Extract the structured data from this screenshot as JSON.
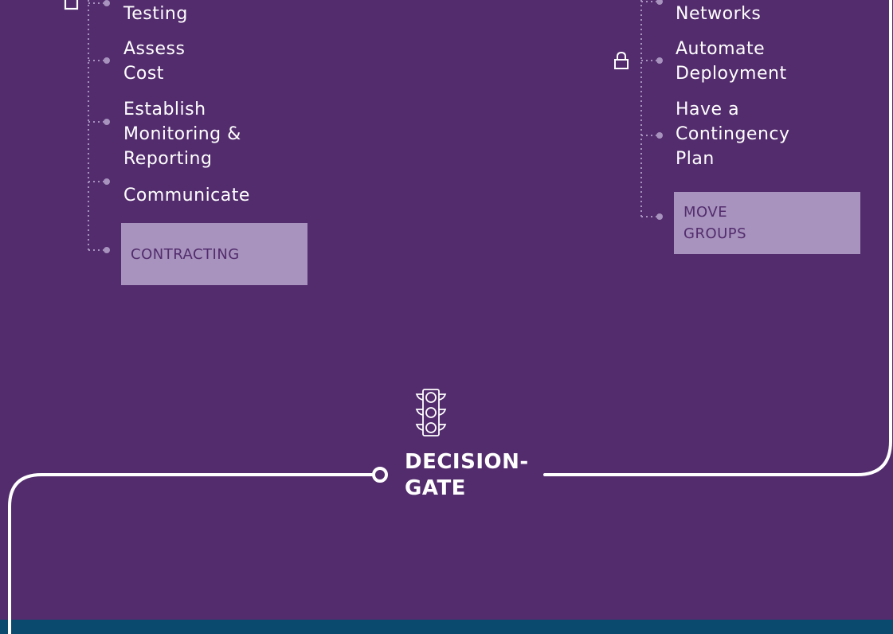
{
  "colors": {
    "background": "#532c6d",
    "box_fill": "#a793bd",
    "box_text": "#532c6d",
    "connector": "#a793bd",
    "bottom_band": "#0a4a6e"
  },
  "left_column": {
    "items": [
      "Testing",
      "Assess\nCost",
      "Establish\nMonitoring &\nReporting",
      "Communicate"
    ],
    "box": "CONTRACTING",
    "marker_icon": "square-outline-icon"
  },
  "right_column": {
    "items": [
      "Networks",
      "Automate\nDeployment",
      "Have a\nContingency\nPlan"
    ],
    "box": "MOVE\nGROUPS",
    "marker_icon": "lock-icon"
  },
  "gate": {
    "label": "DECISION-\nGATE",
    "icon": "traffic-light-icon"
  }
}
